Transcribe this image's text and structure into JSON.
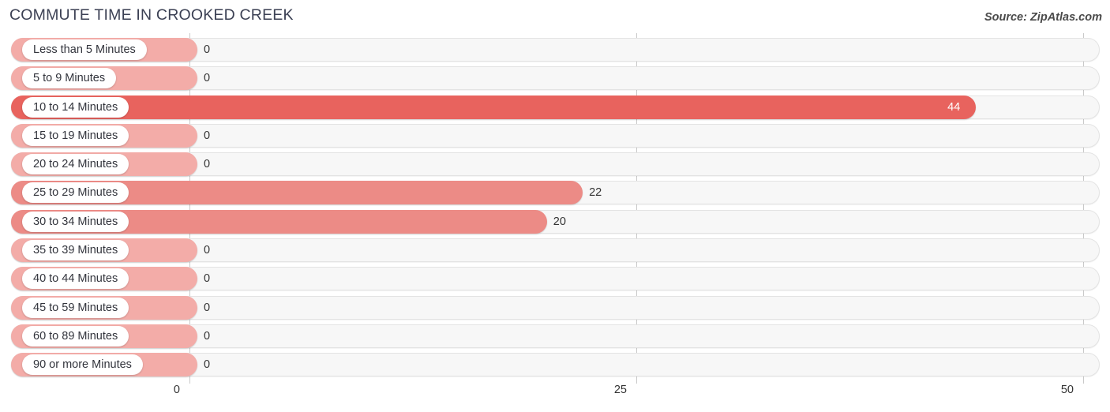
{
  "header": {
    "title": "COMMUTE TIME IN CROOKED CREEK",
    "source": "Source: ZipAtlas.com"
  },
  "colors": {
    "bar_high": "#e8635e",
    "bar_mid": "#ec8b86",
    "bar_zero": "#f3aca8",
    "track": "#f7f7f7",
    "gridline": "#c9c9c9",
    "title_text": "#3c4154"
  },
  "chart_data": {
    "type": "bar",
    "orientation": "horizontal",
    "title": "COMMUTE TIME IN CROOKED CREEK",
    "xlabel": "",
    "ylabel": "",
    "xlim": [
      0,
      50
    ],
    "xticks": [
      "0",
      "25",
      "50"
    ],
    "grid": true,
    "legend": false,
    "categories": [
      "Less than 5 Minutes",
      "5 to 9 Minutes",
      "10 to 14 Minutes",
      "15 to 19 Minutes",
      "20 to 24 Minutes",
      "25 to 29 Minutes",
      "30 to 34 Minutes",
      "35 to 39 Minutes",
      "40 to 44 Minutes",
      "45 to 59 Minutes",
      "60 to 89 Minutes",
      "90 or more Minutes"
    ],
    "values": [
      0,
      0,
      44,
      0,
      0,
      22,
      20,
      0,
      0,
      0,
      0,
      0
    ],
    "value_labels": [
      "0",
      "0",
      "44",
      "0",
      "0",
      "22",
      "20",
      "0",
      "0",
      "0",
      "0",
      "0"
    ]
  }
}
